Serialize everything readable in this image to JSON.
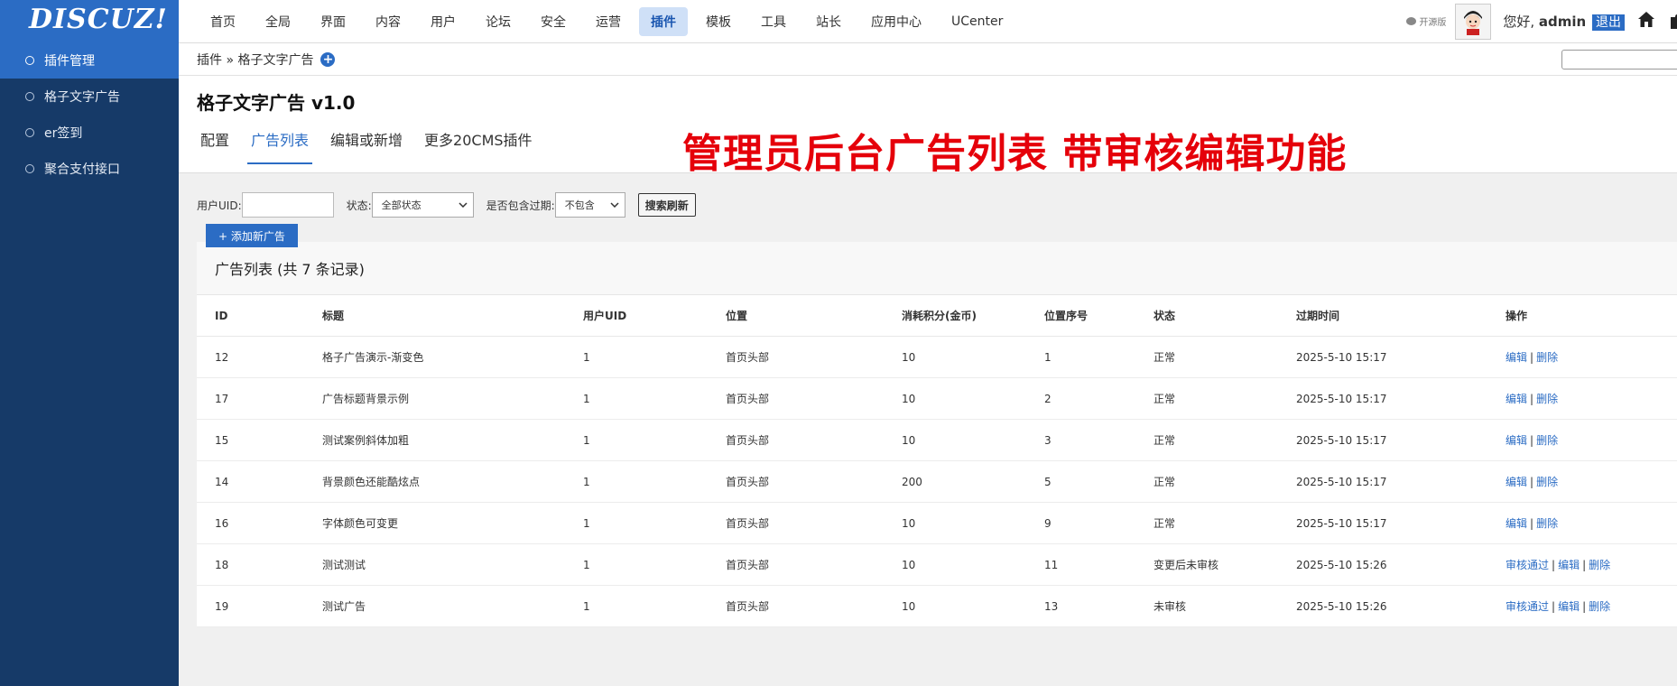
{
  "app": {
    "logo": "DISCUZ!",
    "colors": {
      "primary": "#2b6cc4",
      "sidebar": "#163a68",
      "promo": "#e5000a"
    }
  },
  "topnav": {
    "items": [
      "首页",
      "全局",
      "界面",
      "内容",
      "用户",
      "论坛",
      "安全",
      "运营",
      "插件",
      "模板",
      "工具",
      "站长",
      "应用中心",
      "UCenter"
    ],
    "active": "插件"
  },
  "topright": {
    "open_source_label": "开源版",
    "greeting": "您好,",
    "username": "admin",
    "logout_label": "退出"
  },
  "sidebar": {
    "items": [
      "插件管理",
      "格子文字广告",
      "er签到",
      "聚合支付接口"
    ],
    "active": "插件管理"
  },
  "breadcrumb": {
    "path": "插件 » 格子文字广告"
  },
  "page": {
    "title": "格子文字广告 v1.0",
    "tabs": [
      "配置",
      "广告列表",
      "编辑或新增",
      "更多20CMS插件"
    ],
    "active_tab": "广告列表",
    "promo_text": "管理员后台广告列表 带审核编辑功能"
  },
  "filter": {
    "uid_label": "用户UID:",
    "uid_value": "",
    "status_label": "状态:",
    "status_selected": "全部状态",
    "expired_label": "是否包含过期:",
    "expired_selected": "不包含",
    "search_button": "搜索刷新",
    "add_button": "+ 添加新广告"
  },
  "table": {
    "title": "广告列表 (共 7 条记录)",
    "columns": [
      "ID",
      "标题",
      "用户UID",
      "位置",
      "消耗积分(金币)",
      "位置序号",
      "状态",
      "过期时间",
      "操作"
    ],
    "rows": [
      {
        "id": "12",
        "title": "格子广告演示-渐变色",
        "uid": "1",
        "position": "首页头部",
        "cost": "10",
        "order": "1",
        "status": "正常",
        "expire": "2025-5-10 15:17",
        "actions": [
          "编辑",
          "删除"
        ]
      },
      {
        "id": "17",
        "title": "广告标题背景示例",
        "uid": "1",
        "position": "首页头部",
        "cost": "10",
        "order": "2",
        "status": "正常",
        "expire": "2025-5-10 15:17",
        "actions": [
          "编辑",
          "删除"
        ]
      },
      {
        "id": "15",
        "title": "测试案例斜体加粗",
        "uid": "1",
        "position": "首页头部",
        "cost": "10",
        "order": "3",
        "status": "正常",
        "expire": "2025-5-10 15:17",
        "actions": [
          "编辑",
          "删除"
        ]
      },
      {
        "id": "14",
        "title": "背景颜色还能酷炫点",
        "uid": "1",
        "position": "首页头部",
        "cost": "200",
        "order": "5",
        "status": "正常",
        "expire": "2025-5-10 15:17",
        "actions": [
          "编辑",
          "删除"
        ]
      },
      {
        "id": "16",
        "title": "字体颜色可变更",
        "uid": "1",
        "position": "首页头部",
        "cost": "10",
        "order": "9",
        "status": "正常",
        "expire": "2025-5-10 15:17",
        "actions": [
          "编辑",
          "删除"
        ]
      },
      {
        "id": "18",
        "title": "测试测试",
        "uid": "1",
        "position": "首页头部",
        "cost": "10",
        "order": "11",
        "status": "变更后未审核",
        "expire": "2025-5-10 15:26",
        "actions": [
          "审核通过",
          "编辑",
          "删除"
        ]
      },
      {
        "id": "19",
        "title": "测试广告",
        "uid": "1",
        "position": "首页头部",
        "cost": "10",
        "order": "13",
        "status": "未审核",
        "expire": "2025-5-10 15:26",
        "actions": [
          "审核通过",
          "编辑",
          "删除"
        ]
      }
    ]
  }
}
